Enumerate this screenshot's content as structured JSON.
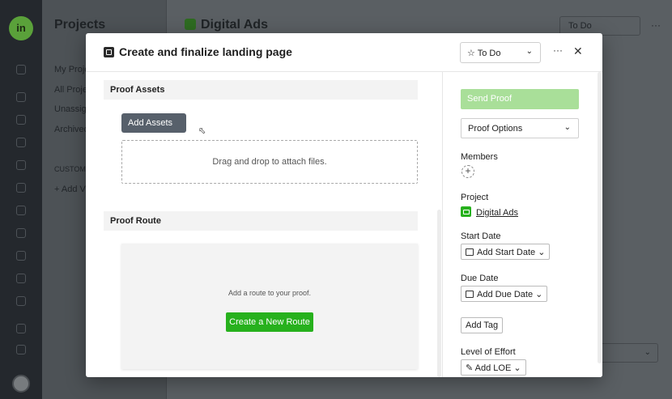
{
  "background": {
    "logo_text": "in",
    "sidebar_title": "Projects",
    "sidebar_items": [
      "My Proje",
      "All Proje",
      "Unassig",
      "Archived"
    ],
    "custom_label": "CUSTOM",
    "add_label": "+ Add V",
    "project_title": "Digital Ads",
    "status": "To Do",
    "more": "···"
  },
  "modal": {
    "title": "Create and finalize landing page",
    "status": "To Do",
    "more": "···",
    "close": "✕",
    "proof_assets": {
      "heading": "Proof Assets",
      "add_assets_label": "Add Assets ⌄",
      "drop_text": "Drag and drop to attach files."
    },
    "proof_route": {
      "heading": "Proof Route",
      "hint": "Add a route to your proof.",
      "create_label": "Create a New Route"
    },
    "side": {
      "send_proof": "Send Proof",
      "proof_options": "Proof Options",
      "members_label": "Members",
      "add_member": "+",
      "project_label": "Project",
      "project_name": "Digital Ads",
      "start_date_label": "Start Date",
      "start_date_btn": "Add Start Date ⌄",
      "due_date_label": "Due Date",
      "due_date_btn": "Add Due Date ⌄",
      "add_tag": "Add Tag",
      "loe_label": "Level of Effort",
      "loe_btn": "Add LOE ⌄"
    }
  },
  "colors": {
    "accent_green": "#27b11d",
    "send_proof_disabled": "#a9df99",
    "dark_button": "#57606b"
  }
}
